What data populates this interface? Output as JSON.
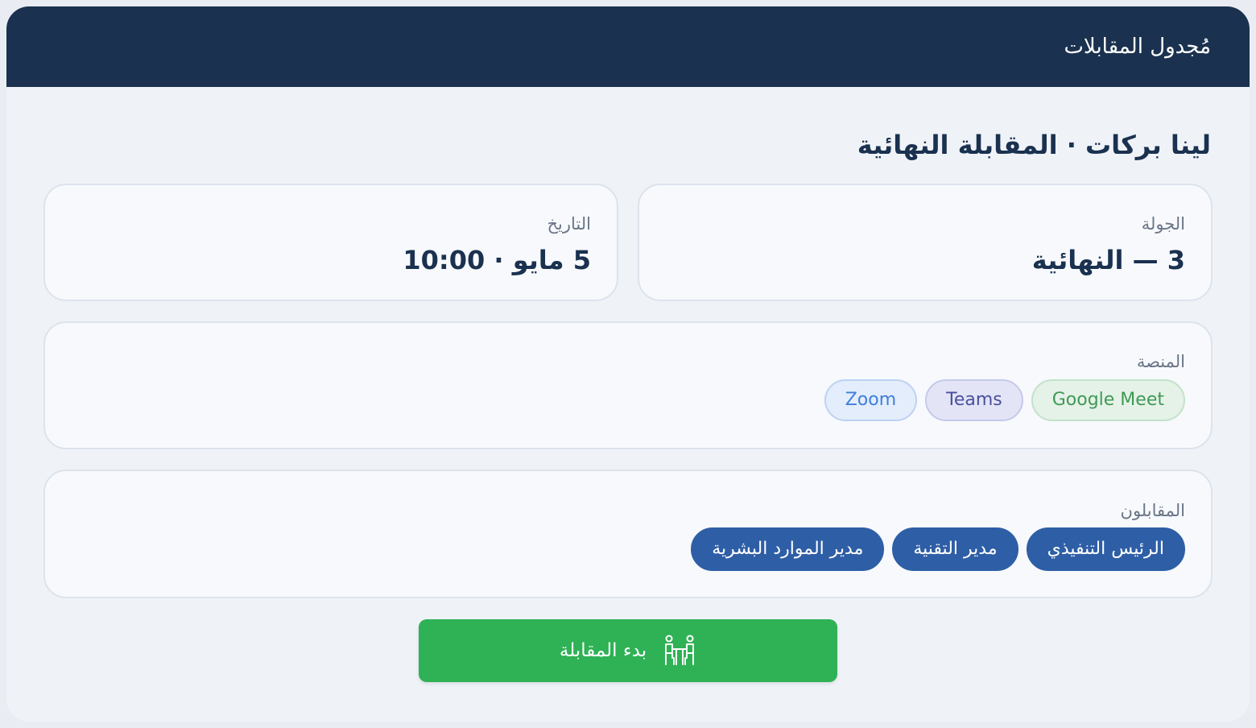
{
  "header": {
    "title": "مُجدول المقابلات"
  },
  "interview": {
    "title": "لينا بركات · المقابلة النهائية"
  },
  "round": {
    "label": "الجولة",
    "value": "3 — النهائية"
  },
  "date": {
    "label": "التاريخ",
    "value": "5 مايو · 10:00"
  },
  "platform": {
    "label": "المنصة",
    "options": [
      "Google Meet",
      "Teams",
      "Zoom"
    ]
  },
  "interviewers": {
    "label": "المقابلون",
    "people": [
      "الرئيس التنفيذي",
      "مدير التقنية",
      "مدير الموارد البشرية"
    ]
  },
  "actions": {
    "start_label": "بدء المقابلة",
    "start_icon": "interview-icon"
  },
  "colors": {
    "header_bg": "#1a314f",
    "accent_blue": "#2e5ea6",
    "start_green": "#2fb155"
  }
}
